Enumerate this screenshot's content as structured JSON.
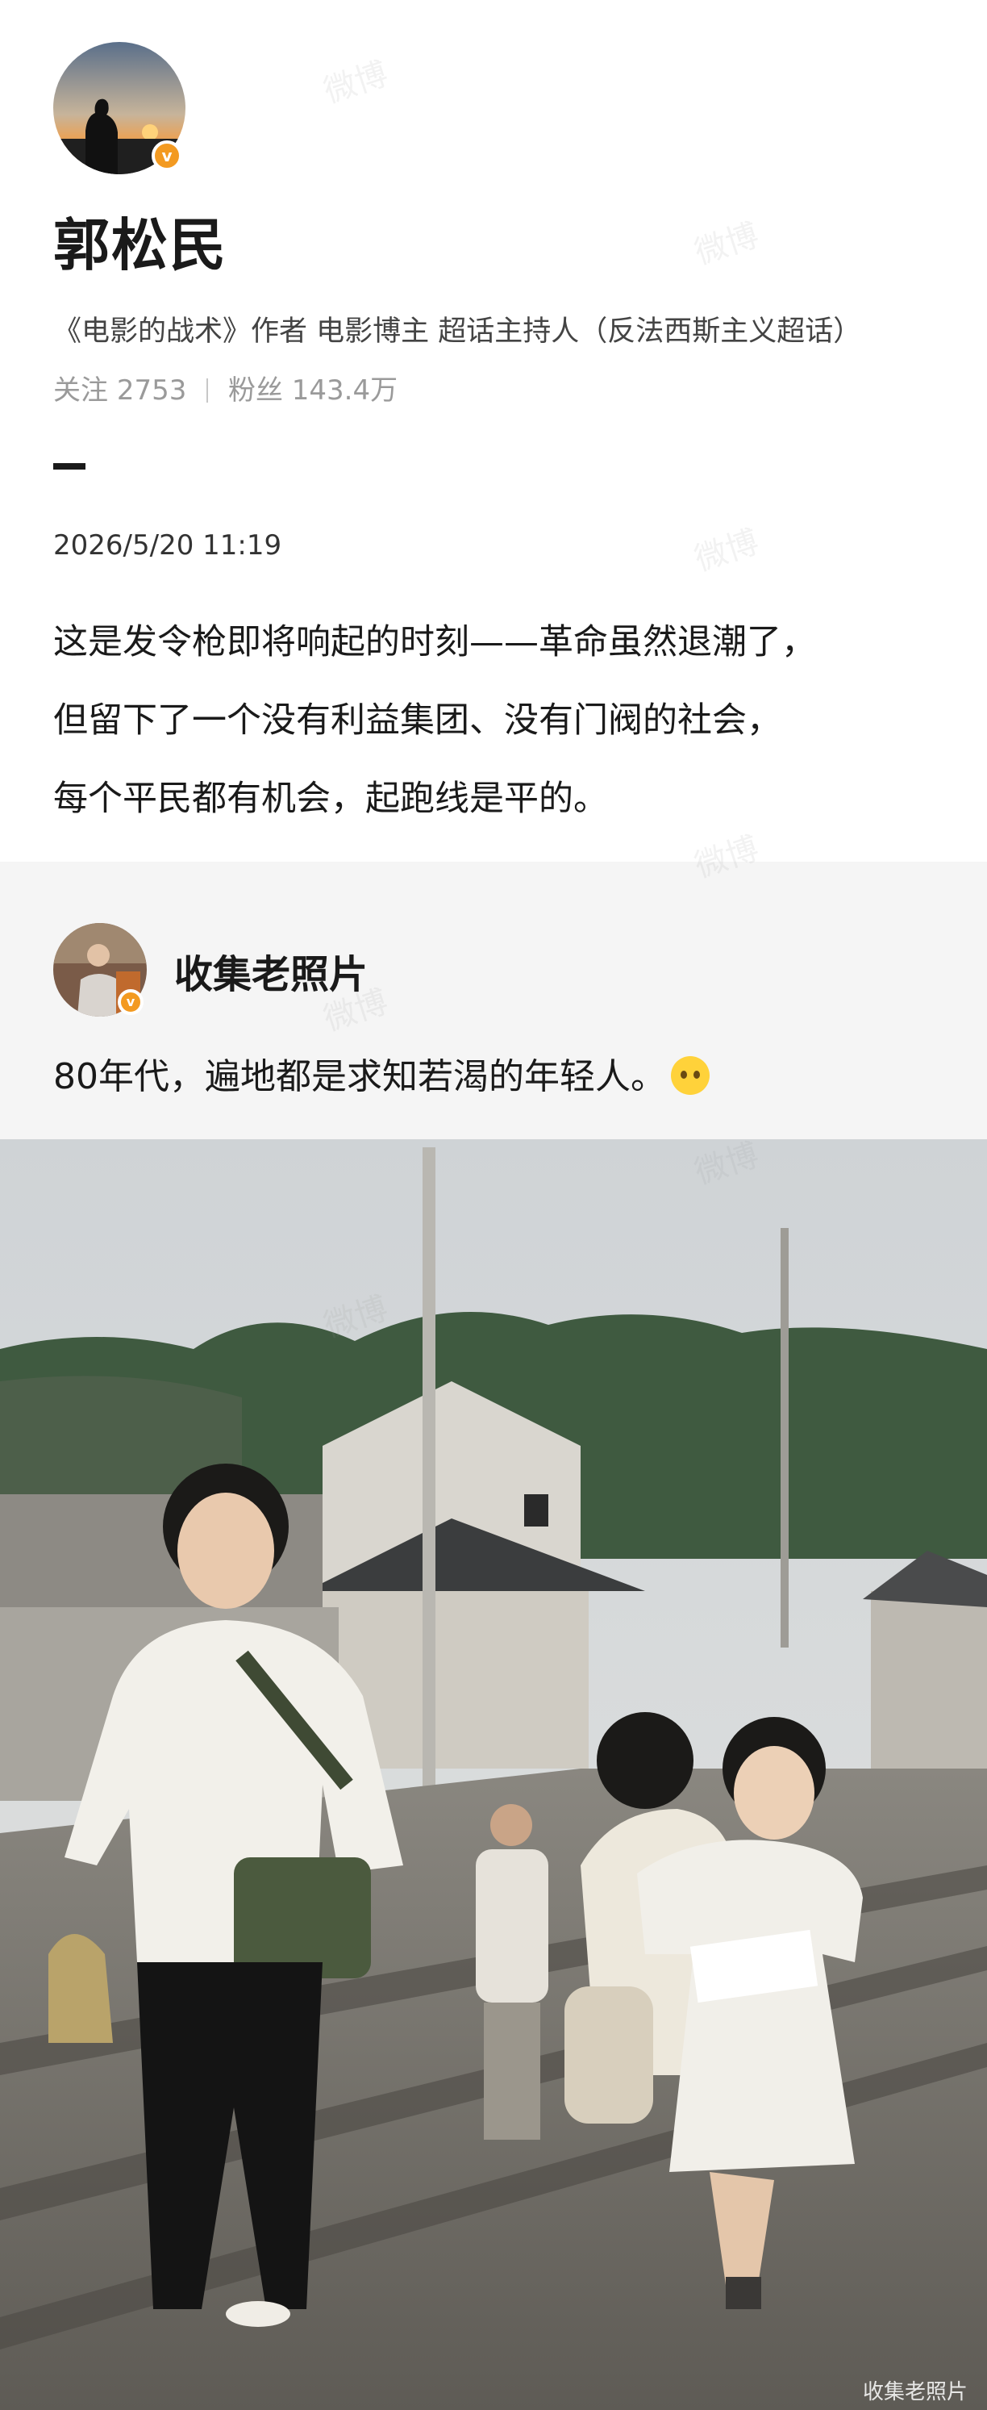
{
  "profile": {
    "name": "郭松民",
    "bio": "《电影的战术》作者 电影博主 超话主持人（反法西斯主义超话）",
    "following_label": "关注",
    "following_count": "2753",
    "followers_label": "粉丝",
    "followers_count": "143.4万"
  },
  "post": {
    "timestamp": "2026/5/20 11:19",
    "lines": [
      "这是发令枪即将响起的时刻——革命虽然退潮了，",
      "但留下了一个没有利益集团、没有门阀的社会，",
      "每个平民都有机会，起跑线是平的。"
    ]
  },
  "repost": {
    "author": "收集老照片",
    "text": "80年代，遍地都是求知若渴的年轻人。",
    "emoji": "crying-face-emoji",
    "photo_credit": "收集老照片"
  },
  "watermark_text": "微博",
  "colors": {
    "verified_badge": "#f39a21",
    "repost_background": "#f5f5f5",
    "muted_text": "#9a9a9a"
  }
}
